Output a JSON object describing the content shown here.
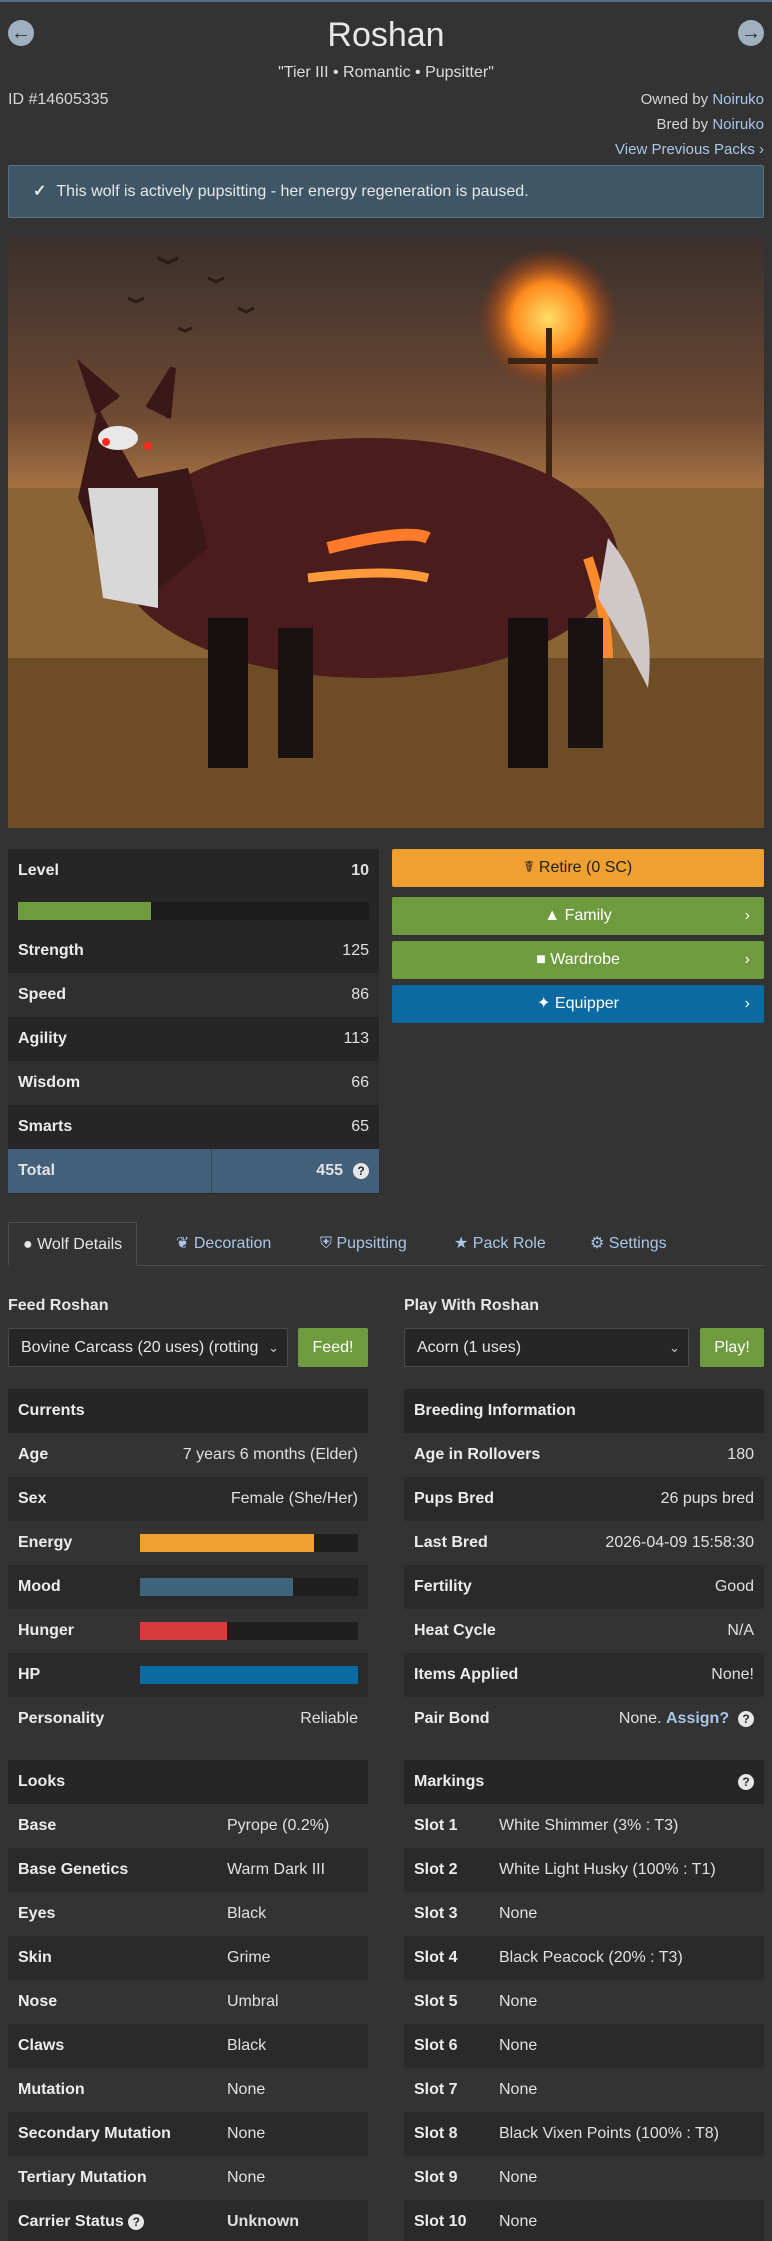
{
  "header": {
    "title": "Roshan",
    "subtitle": "\"Tier III • Romantic • Pupsitter\"",
    "id_label": "ID #14605335",
    "owned_prefix": "Owned by",
    "owned_name": "Noiruko",
    "bred_prefix": "Bred by",
    "bred_name": "Noiruko",
    "view_packs": "View Previous Packs",
    "prev_icon": "arrow-left-circle-icon",
    "next_icon": "arrow-right-circle-icon"
  },
  "alert": {
    "text": "This wolf is actively pupsitting - her energy regeneration is paused.",
    "icon": "check-icon"
  },
  "stats": {
    "level_label": "Level",
    "level_value": "10",
    "level_progress": 0.38,
    "rows": [
      {
        "label": "Strength",
        "value": "125"
      },
      {
        "label": "Speed",
        "value": "86"
      },
      {
        "label": "Agility",
        "value": "113"
      },
      {
        "label": "Wisdom",
        "value": "66"
      },
      {
        "label": "Smarts",
        "value": "65"
      }
    ],
    "total_label": "Total",
    "total_value": "455"
  },
  "actions": {
    "retire": "Retire (0 SC)",
    "family": "Family",
    "wardrobe": "Wardrobe",
    "equipper": "Equipper",
    "colors": {
      "retire": "#f0a030",
      "family": "#6d9b3d",
      "wardrobe": "#6d9b3d",
      "equipper": "#0b6aa2"
    }
  },
  "tabs": [
    {
      "label": "Wolf Details",
      "icon": "paw-icon"
    },
    {
      "label": "Decoration",
      "icon": "feather-icon"
    },
    {
      "label": "Pupsitting",
      "icon": "shield-icon"
    },
    {
      "label": "Pack Role",
      "icon": "star-icon"
    },
    {
      "label": "Settings",
      "icon": "gear-icon"
    }
  ],
  "feed": {
    "label": "Feed Roshan",
    "selected": "Bovine Carcass (20 uses) (rotting",
    "button": "Feed!"
  },
  "play": {
    "label": "Play With Roshan",
    "selected": "Acorn (1 uses)",
    "button": "Play!"
  },
  "currents": {
    "title": "Currents",
    "age_label": "Age",
    "age": "7 years 6 months (Elder)",
    "sex_label": "Sex",
    "sex": "Female (She/Her)",
    "energy_label": "Energy",
    "energy": 0.8,
    "mood_label": "Mood",
    "mood": 0.7,
    "hunger_label": "Hunger",
    "hunger": 0.4,
    "hp_label": "HP",
    "hp": 1.0,
    "personality_label": "Personality",
    "personality": "Reliable",
    "bar_colors": {
      "energy": "#f0a030",
      "mood": "#3e6479",
      "hunger": "#d63c3c",
      "hp": "#0b6aa2"
    }
  },
  "breeding": {
    "title": "Breeding Information",
    "rows": [
      {
        "label": "Age in Rollovers",
        "value": "180"
      },
      {
        "label": "Pups Bred",
        "value": "26 pups bred"
      },
      {
        "label": "Last Bred",
        "value": "2026-04-09 15:58:30"
      },
      {
        "label": "Fertility",
        "value": "Good"
      },
      {
        "label": "Heat Cycle",
        "value": "N/A"
      },
      {
        "label": "Items Applied",
        "value": "None!"
      }
    ],
    "pair_label": "Pair Bond",
    "pair_value": "None.",
    "pair_link": "Assign?"
  },
  "looks": {
    "title": "Looks",
    "rows": [
      {
        "label": "Base",
        "value": "Pyrope (0.2%)"
      },
      {
        "label": "Base Genetics",
        "value": "Warm Dark III"
      },
      {
        "label": "Eyes",
        "value": "Black"
      },
      {
        "label": "Skin",
        "value": "Grime"
      },
      {
        "label": "Nose",
        "value": "Umbral"
      },
      {
        "label": "Claws",
        "value": "Black"
      },
      {
        "label": "Mutation",
        "value": "None"
      },
      {
        "label": "Secondary Mutation",
        "value": "None"
      },
      {
        "label": "Tertiary Mutation",
        "value": "None"
      }
    ],
    "carrier_label": "Carrier Status",
    "carrier_value": "Unknown"
  },
  "markings": {
    "title": "Markings",
    "rows": [
      {
        "label": "Slot 1",
        "value": "White Shimmer (3% : T3)"
      },
      {
        "label": "Slot 2",
        "value": "White Light Husky (100% : T1)"
      },
      {
        "label": "Slot 3",
        "value": "None"
      },
      {
        "label": "Slot 4",
        "value": "Black Peacock (20% : T3)"
      },
      {
        "label": "Slot 5",
        "value": "None"
      },
      {
        "label": "Slot 6",
        "value": "None"
      },
      {
        "label": "Slot 7",
        "value": "None"
      },
      {
        "label": "Slot 8",
        "value": "Black Vixen Points (100% : T8)"
      },
      {
        "label": "Slot 9",
        "value": "None"
      },
      {
        "label": "Slot 10",
        "value": "None"
      }
    ]
  }
}
